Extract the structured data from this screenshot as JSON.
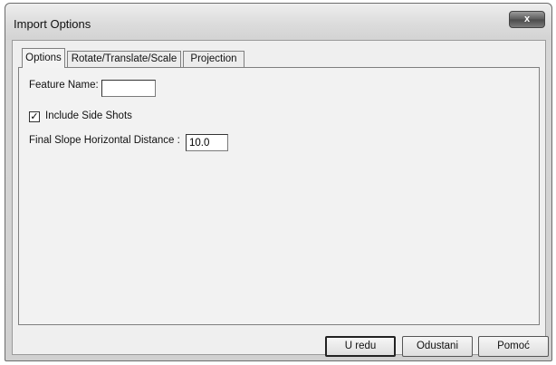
{
  "window": {
    "title": "Import Options",
    "close_icon": "close-icon",
    "close_label": "x"
  },
  "tabs": [
    {
      "label": "Options",
      "active": true
    },
    {
      "label": "Rotate/Translate/Scale",
      "active": false
    },
    {
      "label": "Projection",
      "active": false
    }
  ],
  "options": {
    "feature_name_label": "Feature Name:",
    "feature_name_value": "",
    "include_side_shots_label": "Include Side Shots",
    "include_side_shots_checked": true,
    "check_mark": "✓",
    "final_slope_label": "Final Slope Horizontal Distance :",
    "final_slope_value": "10.0"
  },
  "buttons": {
    "ok_label": "U redu",
    "cancel_label": "Odustani",
    "help_label": "Pomoć"
  }
}
